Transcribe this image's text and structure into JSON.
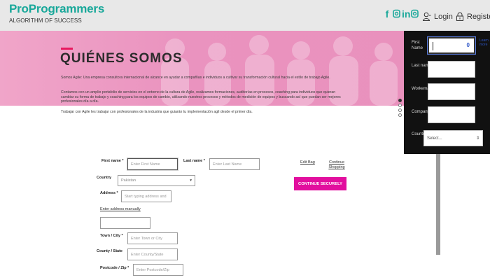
{
  "brand": {
    "title": "ProProgrammers",
    "subtitle": "ALGORITHM OF SUCCESS",
    "accent": "#19a89a"
  },
  "header": {
    "social": [
      "facebook-icon",
      "instagram-icon",
      "linkedin-icon",
      "instagram-icon"
    ],
    "login_label": "Login",
    "register_label": "Register"
  },
  "hero": {
    "title": "QUIÉNES SOMOS",
    "paragraph1": "Somos Agile: Una empresa consultora internacional de alcance en ayudar a compañías e individuos a cultivar su transformación cultural hacia el estilo de trabajo Agile.",
    "paragraph2": "Contamos con un amplio portafolio de servicios en el entorno de la cultura de Agile, realizamos formaciones, auditorías en procesos, coaching para individuos que quieran cambiar su forma de trabajo y coaching para los equipos de cambio, utilizando nuestros procesos y métodos de medición de equipos y buscando así que puedan ser mejores profesionales día a día.",
    "paragraph3": "Trabajar con Agile les trabajar con profesionales de la industria que guiarán tu implementación agil desde el primer día.",
    "accent": "#e8195f"
  },
  "slider_dots": 4,
  "form": {
    "first_name_label": "First name *",
    "first_name_placeholder": "Enter First Name",
    "last_name_label": "Last name *",
    "last_name_placeholder": "Enter Last Name",
    "country_label": "Country",
    "country_value": "Pakistan",
    "address_label": "Address *",
    "address_placeholder": "Start typing address and",
    "enter_manually": "Enter address manually",
    "town_label": "Town / City *",
    "town_placeholder": "Enter Town or City",
    "county_label": "County / State",
    "county_placeholder": "Enter County/State",
    "postcode_label": "Postcode / Zip *",
    "postcode_placeholder": "Enter Postcode/Zip"
  },
  "cart": {
    "edit_bag": "Edit Bag",
    "continue_shopping": "Continue Shopping",
    "continue_securely": "CONTINUE SECURELY",
    "button_color": "#e20f9e"
  },
  "panel": {
    "first_name": "First Name",
    "last_name": "Last name",
    "work_email": "Workemail",
    "company": "Company",
    "country": "Country",
    "country_select": "Select...",
    "counter": "0",
    "side_link": "Learn more"
  }
}
